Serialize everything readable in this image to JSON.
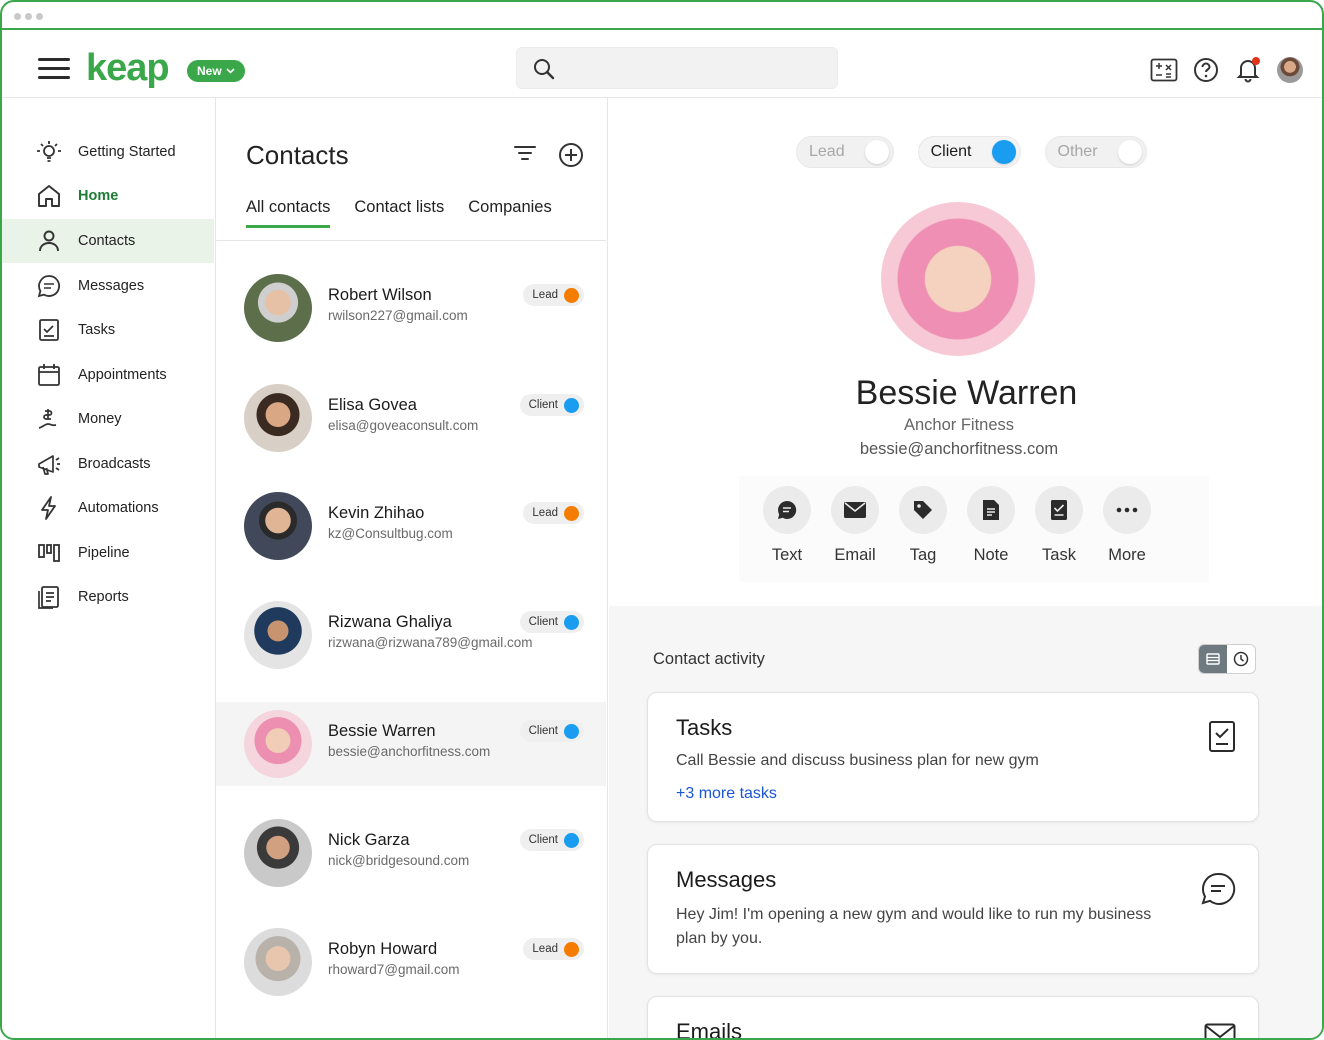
{
  "app": {
    "logo_text": "keap",
    "new_button_label": "New"
  },
  "search": {
    "placeholder": ""
  },
  "sidebar": {
    "items": [
      {
        "label": "Getting Started",
        "icon": "lightbulb-icon"
      },
      {
        "label": "Home",
        "icon": "home-icon"
      },
      {
        "label": "Contacts",
        "icon": "person-icon"
      },
      {
        "label": "Messages",
        "icon": "chat-bubble-icon"
      },
      {
        "label": "Tasks",
        "icon": "checklist-icon"
      },
      {
        "label": "Appointments",
        "icon": "calendar-icon"
      },
      {
        "label": "Money",
        "icon": "money-icon"
      },
      {
        "label": "Broadcasts",
        "icon": "megaphone-icon"
      },
      {
        "label": "Automations",
        "icon": "lightning-icon"
      },
      {
        "label": "Pipeline",
        "icon": "pipeline-icon"
      },
      {
        "label": "Reports",
        "icon": "reports-icon"
      }
    ]
  },
  "contacts": {
    "title": "Contacts",
    "tabs": [
      "All contacts",
      "Contact lists",
      "Companies"
    ],
    "list": [
      {
        "name": "Robert Wilson",
        "email": "rwilson227@gmail.com",
        "status": "Lead"
      },
      {
        "name": "Elisa Govea",
        "email": "elisa@goveaconsult.com",
        "status": "Client"
      },
      {
        "name": "Kevin Zhihao",
        "email": "kz@Consultbug.com",
        "status": "Lead"
      },
      {
        "name": "Rizwana Ghaliya",
        "email": "rizwana@rizwana789@gmail.com",
        "status": "Client"
      },
      {
        "name": "Bessie Warren",
        "email": "bessie@anchorfitness.com",
        "status": "Client"
      },
      {
        "name": "Nick Garza",
        "email": "nick@bridgesound.com",
        "status": "Client"
      },
      {
        "name": "Robyn Howard",
        "email": "rhoward7@gmail.com",
        "status": "Lead"
      }
    ]
  },
  "detail": {
    "toggles": [
      "Lead",
      "Client",
      "Other"
    ],
    "active_toggle": "Client",
    "name": "Bessie Warren",
    "company": "Anchor Fitness",
    "email": "bessie@anchorfitness.com",
    "actions": [
      "Text",
      "Email",
      "Tag",
      "Note",
      "Task",
      "More"
    ]
  },
  "activity": {
    "title": "Contact activity",
    "tasks": {
      "title": "Tasks",
      "text": "Call Bessie and discuss business plan for new gym",
      "link": "+3 more tasks"
    },
    "messages": {
      "title": "Messages",
      "text": "Hey Jim! I'm opening a new gym and would like to run my business plan by you."
    },
    "emails": {
      "title": "Emails"
    }
  },
  "colors": {
    "brand_green": "#3aa74a",
    "lead_orange": "#f57c00",
    "client_blue": "#1a9cf0",
    "link_blue": "#1a54d8"
  }
}
